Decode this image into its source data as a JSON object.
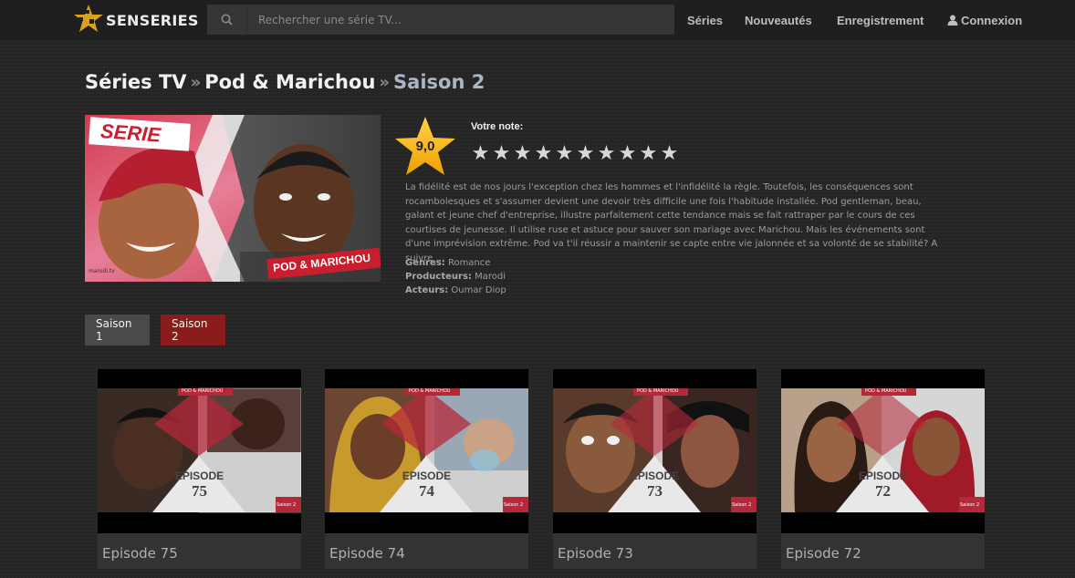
{
  "header": {
    "logo_text": "SENSERIES",
    "search_placeholder": "Rechercher une série TV...",
    "nav": {
      "series": "Séries",
      "new": "Nouveautés",
      "recording": "Enregistrement",
      "login": "Connexion"
    }
  },
  "breadcrumb": {
    "root": "Séries TV",
    "sep": "»",
    "show": "Pod & Marichou",
    "current": "Saison 2"
  },
  "poster": {
    "badge": "SERIE",
    "caption": "POD & MARICHOU",
    "channel": "marodi.tv"
  },
  "rating": {
    "value": "9,0",
    "vote_label": "Votre note:",
    "vote_stars": [
      "★",
      "★",
      "★",
      "★",
      "★",
      "★",
      "★",
      "★",
      "★",
      "★"
    ]
  },
  "description": "La fidélité est de nos jours l'exception chez les hommes et l'infidélité la règle. Toutefois, les conséquences sont rocambolesques et s'assumer devient une devoir très difficile une fois l'habitude installée. Pod gentleman, beau, galant et jeune chef d'entreprise, illustre parfaitement cette tendance mais se fait rattraper par le cours de ces courtises de jeunesse. Il utilise ruse et astuce pour sauver son mariage avec Marichou. Mais les événements sont d'une imprévision extrême. Pod va t'il réussir a maintenir se capte entre vie jalonnée et sa volonté de se stabilité? A suivre ...",
  "meta": {
    "genres_label": "Genres:",
    "genres": "Romance",
    "producers_label": "Producteurs:",
    "producers": "Marodi",
    "actors_label": "Acteurs:",
    "actors": "Oumar Diop"
  },
  "seasons": [
    {
      "label": "Saison 1",
      "active": false
    },
    {
      "label": "Saison 2",
      "active": true
    }
  ],
  "episodes": [
    {
      "title": "Episode 75",
      "thumb_top": "POD & MARICHOU",
      "thumb_word": "EPISODE",
      "thumb_num": "75",
      "thumb_season": "Saison 2"
    },
    {
      "title": "Episode 74",
      "thumb_top": "POD & MARICHOU",
      "thumb_word": "EPISODE",
      "thumb_num": "74",
      "thumb_season": "Saison 2"
    },
    {
      "title": "Episode 73",
      "thumb_top": "POD & MARICHOU",
      "thumb_word": "EPISODE",
      "thumb_num": "73",
      "thumb_season": "Saison 2"
    },
    {
      "title": "Episode 72",
      "thumb_top": "POD & MARICHOU",
      "thumb_word": "EPISODE",
      "thumb_num": "72",
      "thumb_season": "Saison 2"
    }
  ],
  "colors": {
    "accent_red": "#8b1c1c",
    "star_gold": "#f5b400",
    "breadcrumb_current": "#a9b6c3"
  }
}
